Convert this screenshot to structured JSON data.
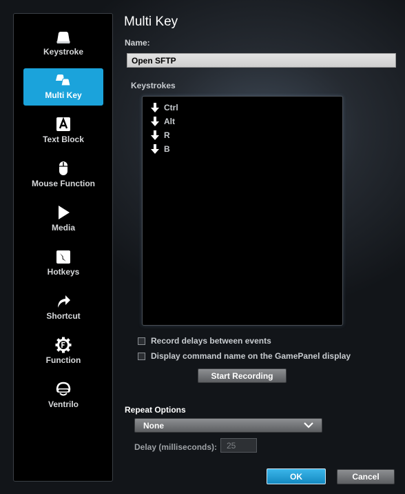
{
  "sidebar": {
    "items": [
      {
        "label": "Keystroke",
        "icon": "keyboard-key-icon",
        "active": false
      },
      {
        "label": "Multi Key",
        "icon": "multi-key-icon",
        "active": true
      },
      {
        "label": "Text Block",
        "icon": "text-block-icon",
        "active": false
      },
      {
        "label": "Mouse Function",
        "icon": "mouse-icon",
        "active": false
      },
      {
        "label": "Media",
        "icon": "play-icon",
        "active": false
      },
      {
        "label": "Hotkeys",
        "icon": "hotkey-icon",
        "active": false
      },
      {
        "label": "Shortcut",
        "icon": "shortcut-arrow-icon",
        "active": false
      },
      {
        "label": "Function",
        "icon": "function-gear-icon",
        "active": false
      },
      {
        "label": "Ventrilo",
        "icon": "headset-icon",
        "active": false
      }
    ]
  },
  "main": {
    "title": "Multi Key",
    "name_label": "Name:",
    "name_value": "Open SFTP",
    "keystrokes_label": "Keystrokes",
    "keystrokes": [
      {
        "key": "Ctrl",
        "direction": "down"
      },
      {
        "key": "Alt",
        "direction": "down"
      },
      {
        "key": "R",
        "direction": "down"
      },
      {
        "key": "B",
        "direction": "down"
      }
    ],
    "record_delays_label": "Record delays between events",
    "display_name_label": "Display command name on the GamePanel display",
    "record_delays_checked": false,
    "display_name_checked": false,
    "start_recording_label": "Start Recording",
    "repeat_options_label": "Repeat Options",
    "repeat_selected": "None",
    "delay_label": "Delay (milliseconds):",
    "delay_value": "25",
    "ok_label": "OK",
    "cancel_label": "Cancel"
  },
  "colors": {
    "accent": "#1ba3db",
    "sidebar_bg": "#000000"
  }
}
